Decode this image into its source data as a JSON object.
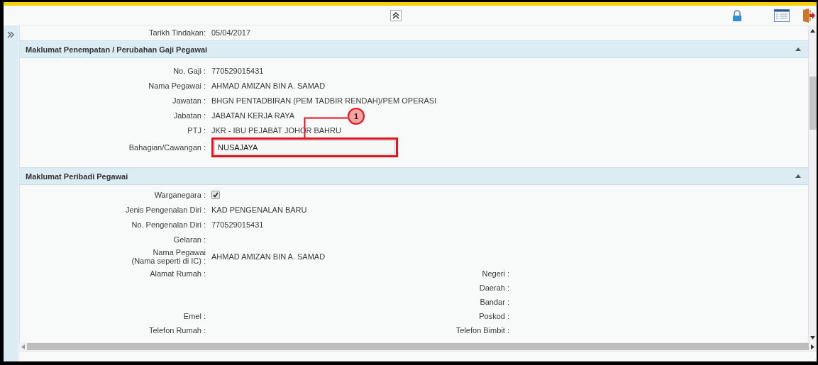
{
  "top_row": {
    "label": "Tarikh Tindakan:",
    "value": "05/04/2017"
  },
  "section_1": {
    "title": "Maklumat Penempatan / Perubahan Gaji Pegawai",
    "expanded": true,
    "fields": [
      {
        "label": "No. Gaji :",
        "value": "770529015431"
      },
      {
        "label": "Nama Pegawai :",
        "value": "AHMAD AMIZAN BIN A. SAMAD"
      },
      {
        "label": "Jawatan :",
        "value": "BHGN PENTADBIRAN (PEM TADBIR RENDAH)/PEM OPERASI"
      },
      {
        "label": "Jabatan :",
        "value": "JABATAN KERJA RAYA"
      },
      {
        "label": "PTJ :",
        "value": "JKR - IBU PEJABAT JOHOR BAHRU"
      }
    ],
    "input": {
      "label": "Bahagian/Cawangan :",
      "value": "NUSAJAYA",
      "highlighted": true,
      "callout": "1"
    }
  },
  "section_2": {
    "title": "Maklumat Peribadi Pegawai",
    "expanded": true,
    "fields": [
      {
        "kind": "checkbox",
        "label": "Warganegara :",
        "checked": true
      },
      {
        "kind": "text",
        "label": "Jenis Pengenalan Diri :",
        "value": "KAD PENGENALAN BARU"
      },
      {
        "kind": "text",
        "label": "No. Pengenalan Diri :",
        "value": "770529015431"
      },
      {
        "kind": "text",
        "label": "Gelaran :"
      },
      {
        "kind": "twoline",
        "label": "Nama Pegawai",
        "sublabel": "(Nama seperti di IC) :",
        "value": "AHMAD AMIZAN BIN A. SAMAD"
      }
    ],
    "address_rows": [
      {
        "label": "Alamat Rumah :",
        "right_label": "Negeri :"
      },
      {
        "right_label": "Daerah :"
      },
      {
        "right_label": "Bandar :"
      },
      {
        "label": "Emel :",
        "right_label": "Poskod :"
      },
      {
        "label": "Telefon Rumah :",
        "right_label": "Telefon Bimbit :"
      }
    ]
  }
}
